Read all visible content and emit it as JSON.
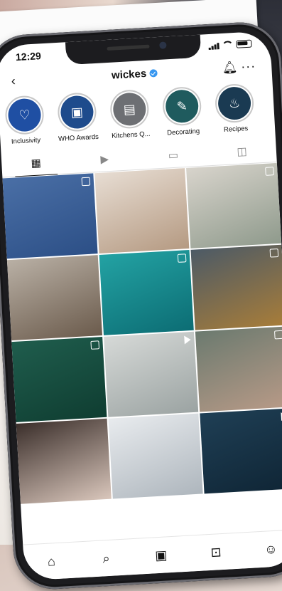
{
  "status": {
    "time": "12:29"
  },
  "header": {
    "username": "wickes",
    "back_icon": "chevron-left-icon",
    "bell_icon": "bell-icon",
    "more_icon": "more-icon"
  },
  "stories": [
    {
      "label": "Inclusivity",
      "color": "#1f4fa3",
      "glyph": "♡",
      "icon": "heart-icon"
    },
    {
      "label": "WHO Awards",
      "color": "#1e4b8c",
      "glyph": "▣",
      "icon": "award-icon"
    },
    {
      "label": "Kitchens Q...",
      "color": "#6d6f73",
      "glyph": "▤",
      "icon": "kitchen-photo-icon"
    },
    {
      "label": "Decorating",
      "color": "#1f5b5e",
      "glyph": "✎",
      "icon": "paint-roller-icon"
    },
    {
      "label": "Recipes",
      "color": "#1a3a52",
      "glyph": "♨",
      "icon": "chef-hat-icon"
    }
  ],
  "tabs": [
    {
      "name": "grid",
      "glyph": "▦",
      "icon": "grid-icon"
    },
    {
      "name": "reels",
      "glyph": "▶",
      "icon": "reels-icon"
    },
    {
      "name": "guides",
      "glyph": "▭",
      "icon": "guide-icon"
    },
    {
      "name": "tagged",
      "glyph": "◫",
      "icon": "tagged-icon"
    }
  ],
  "posts": [
    {
      "colors": [
        "#4a6fa6",
        "#2c4f86"
      ],
      "kind": "badge"
    },
    {
      "colors": [
        "#e7ddd3",
        "#b59a82"
      ],
      "kind": "none"
    },
    {
      "colors": [
        "#d8d4cc",
        "#8f9a8c"
      ],
      "kind": "badge"
    },
    {
      "colors": [
        "#b9b0a5",
        "#6b5b4c"
      ],
      "kind": "none"
    },
    {
      "colors": [
        "#23a2a3",
        "#0c6d74"
      ],
      "kind": "badge"
    },
    {
      "colors": [
        "#4c5a66",
        "#a87d39"
      ],
      "kind": "badge"
    },
    {
      "colors": [
        "#1f5d4d",
        "#0f3d31"
      ],
      "kind": "badge"
    },
    {
      "colors": [
        "#d6d9d7",
        "#9ba3a2"
      ],
      "kind": "play"
    },
    {
      "colors": [
        "#6b7a6f",
        "#b89a87"
      ],
      "kind": "badge"
    },
    {
      "colors": [
        "#3b2f2b",
        "#d9c6bb"
      ],
      "kind": "none"
    },
    {
      "colors": [
        "#e8ebee",
        "#aeb6bd"
      ],
      "kind": "none"
    },
    {
      "colors": [
        "#1f3f55",
        "#0f2535"
      ],
      "kind": "play"
    }
  ],
  "bottom_nav": [
    {
      "name": "home",
      "glyph": "⌂",
      "icon": "home-icon"
    },
    {
      "name": "search",
      "glyph": "⌕",
      "icon": "search-icon"
    },
    {
      "name": "reels",
      "glyph": "▣",
      "icon": "reels-icon"
    },
    {
      "name": "shop",
      "glyph": "⊡",
      "icon": "shop-icon"
    },
    {
      "name": "profile",
      "glyph": "☺",
      "icon": "profile-icon"
    }
  ]
}
